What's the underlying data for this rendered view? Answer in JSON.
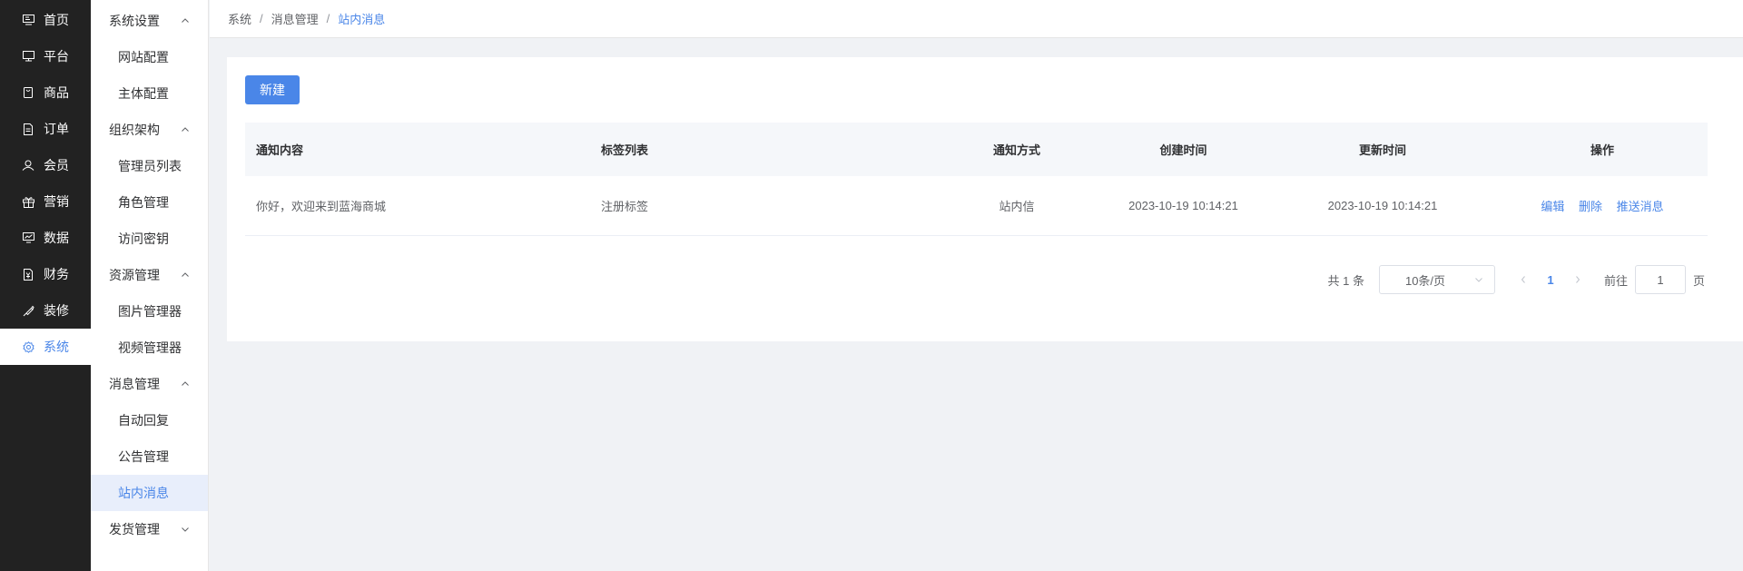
{
  "primary_nav": [
    {
      "label": "首页",
      "icon": "monitor-icon",
      "active": false
    },
    {
      "label": "平台",
      "icon": "display-icon",
      "active": false
    },
    {
      "label": "商品",
      "icon": "bag-icon",
      "active": false
    },
    {
      "label": "订单",
      "icon": "document-icon",
      "active": false
    },
    {
      "label": "会员",
      "icon": "users-icon",
      "active": false
    },
    {
      "label": "营销",
      "icon": "gift-icon",
      "active": false
    },
    {
      "label": "数据",
      "icon": "chart-icon",
      "active": false
    },
    {
      "label": "财务",
      "icon": "finance-icon",
      "active": false
    },
    {
      "label": "装修",
      "icon": "brush-icon",
      "active": false
    },
    {
      "label": "系统",
      "icon": "gear-icon",
      "active": true
    }
  ],
  "secondary_nav": {
    "system_settings": {
      "label": "系统设置",
      "items": [
        "网站配置",
        "主体配置"
      ]
    },
    "organization": {
      "label": "组织架构",
      "items": [
        "管理员列表",
        "角色管理",
        "访问密钥"
      ]
    },
    "resources": {
      "label": "资源管理",
      "items": [
        "图片管理器",
        "视频管理器"
      ]
    },
    "messages": {
      "label": "消息管理",
      "items": [
        "自动回复",
        "公告管理",
        "站内消息"
      ]
    },
    "shipping": {
      "label": "发货管理"
    }
  },
  "breadcrumb": {
    "level1": "系统",
    "level2": "消息管理",
    "current": "站内消息",
    "separator": "/"
  },
  "toolbar": {
    "new_label": "新建"
  },
  "table": {
    "headers": {
      "content": "通知内容",
      "tags": "标签列表",
      "method": "通知方式",
      "created": "创建时间",
      "updated": "更新时间",
      "actions": "操作"
    },
    "rows": [
      {
        "content": "你好，欢迎来到蓝海商城",
        "tags": "注册标签",
        "method": "站内信",
        "created": "2023-10-19 10:14:21",
        "updated": "2023-10-19 10:14:21",
        "edit": "编辑",
        "delete": "删除",
        "push": "推送消息"
      }
    ]
  },
  "pagination": {
    "total": "共 1 条",
    "page_size": "10条/页",
    "current_page": "1",
    "goto_prefix": "前往",
    "goto_value": "1",
    "goto_suffix": "页"
  },
  "colors": {
    "accent": "#4a86e8",
    "sidebar_dark": "#222222",
    "active_bg": "#e8eefb"
  }
}
